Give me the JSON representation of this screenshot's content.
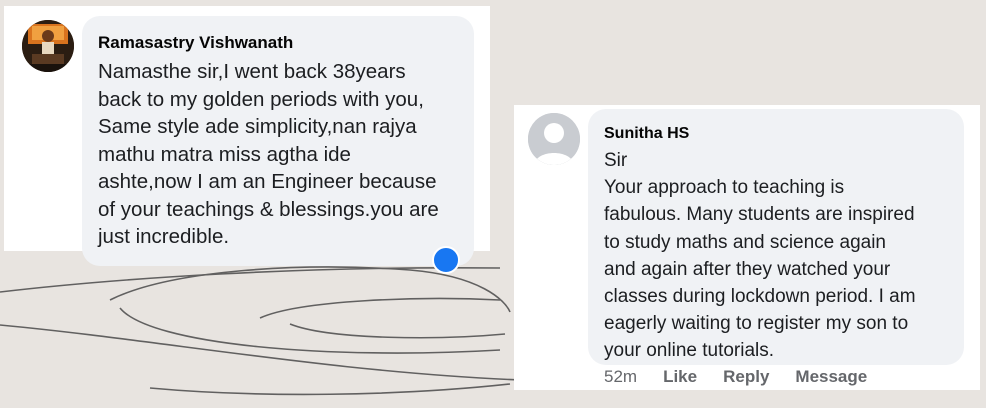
{
  "comments": [
    {
      "author": "Ramasastry Vishwanath",
      "text": "Namasthe sir,I went back 38years\nback to my golden periods with you,\nSame style ade simplicity,nan rajya\nmathu matra miss agtha ide\nashte,now I am an Engineer because\nof your teachings & blessings.you are\njust incredible.",
      "avatar_icon": "profile-photo"
    },
    {
      "author": "Sunitha HS",
      "text": "Sir\n      Your approach to teaching is\nfabulous. Many students are inspired\nto study maths and science again\nand again after they watched your\nclasses during lockdown period. I am\neagerly waiting to register my son to\nyour online tutorials.",
      "avatar_icon": "default-avatar-icon",
      "time": "52m",
      "actions": [
        "Like",
        "Reply",
        "Message"
      ]
    }
  ],
  "colors": {
    "bubble": "#f0f2f5",
    "author": "#050505",
    "meta": "#65676b",
    "accent": "#1877f2",
    "background": "#e8e4e0"
  }
}
